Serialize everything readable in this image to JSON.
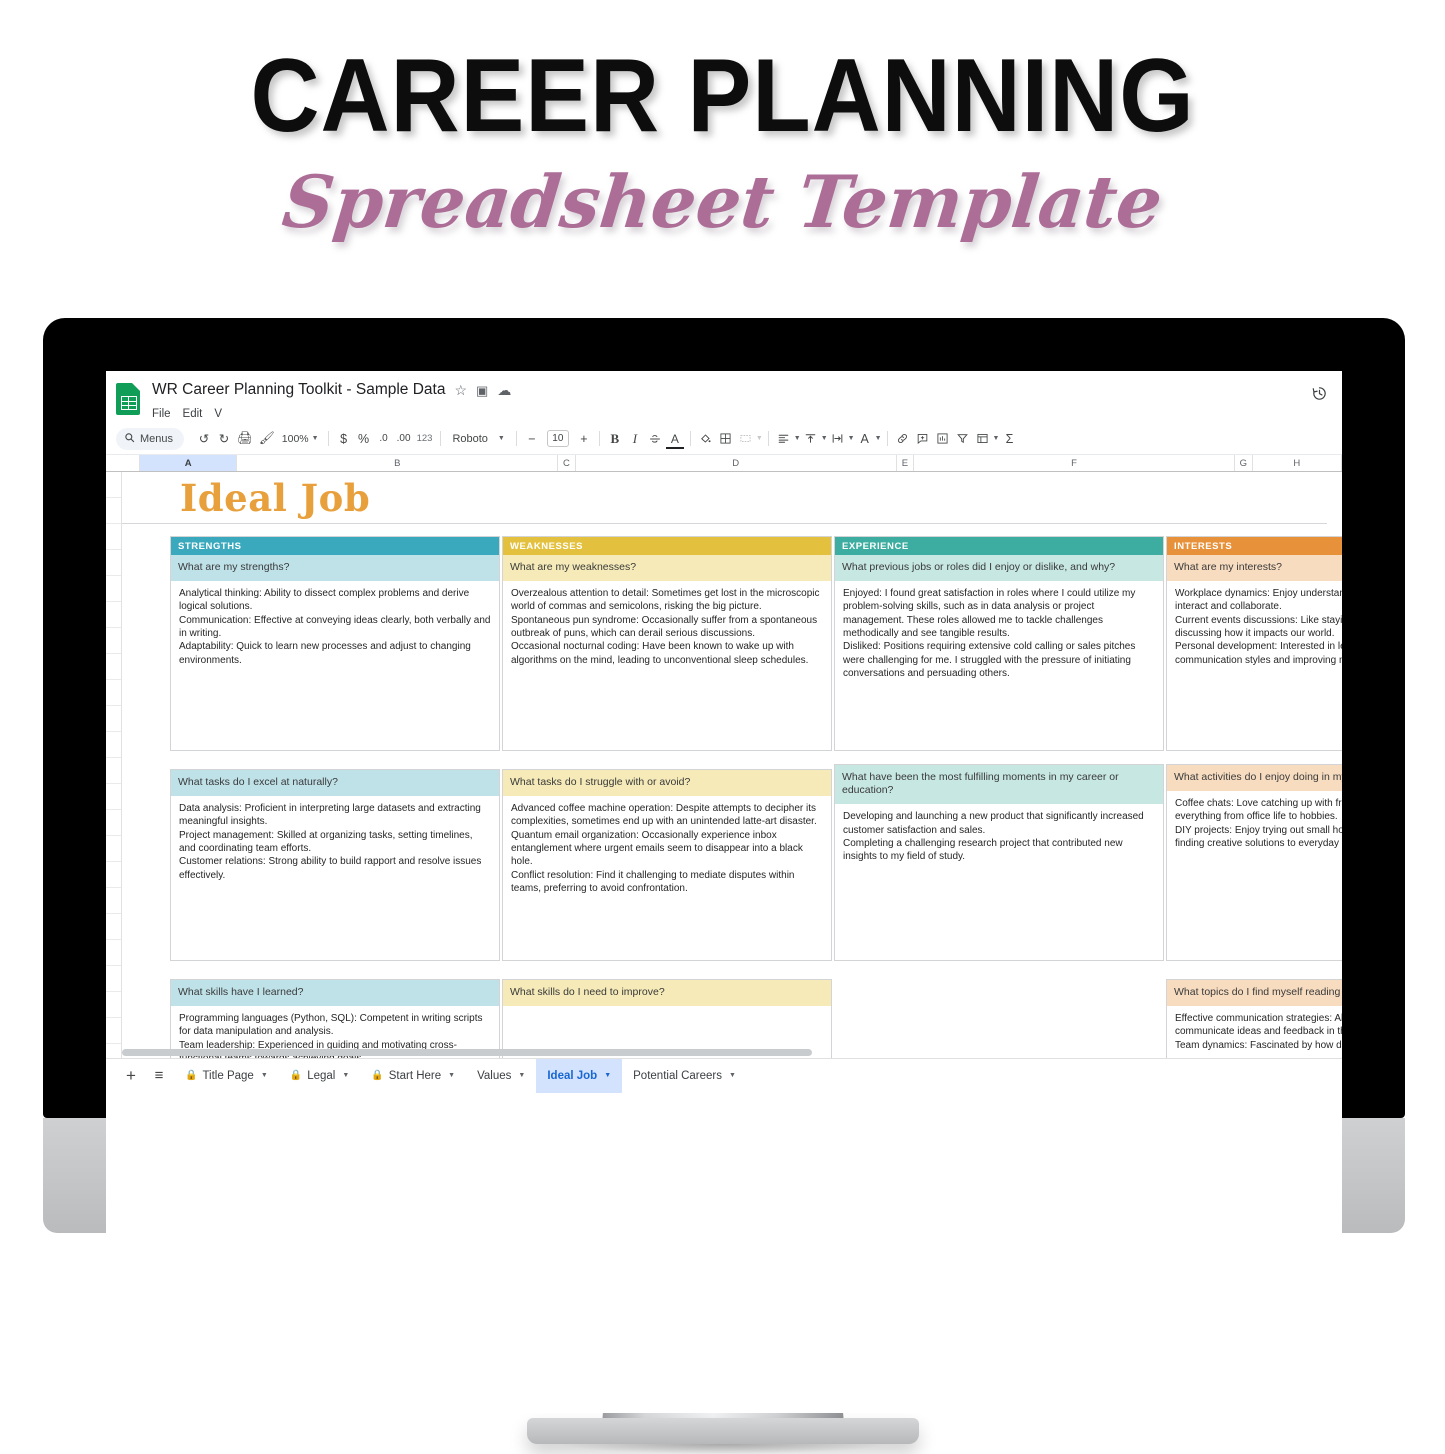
{
  "promo": {
    "title": "CAREER PLANNING",
    "subtitle": "Spreadsheet Template"
  },
  "app": {
    "filename": "WR Career Planning Toolkit - Sample Data",
    "icons": {
      "doc": "sheets-logo",
      "star": "☆",
      "move": "▣",
      "cloud": "☁",
      "history": "🕘"
    },
    "menus": [
      "File",
      "Edit",
      "V"
    ]
  },
  "toolbar": {
    "menus_label": "Menus",
    "search_icon": "search-icon",
    "undo": "↺",
    "redo": "↻",
    "print": "🖨",
    "paint": "🖌",
    "zoom": "100%",
    "currency": "$",
    "percent": "%",
    "decrease_decimal": ".0",
    "increase_decimal": ".00",
    "more_formats": "123",
    "font": "Roboto",
    "font_size": "10",
    "size_minus": "−",
    "size_plus": "+",
    "bold": "B",
    "italic": "I",
    "strikethrough": "S",
    "text_color": "A",
    "fill_color": "🖍",
    "borders": "▦",
    "merge": "⧉",
    "halign": "≡",
    "valign": "⊤",
    "wrap": "↵",
    "rotate": "A",
    "link": "🔗",
    "comment": "⊞",
    "chart": "▥",
    "filter": "▽",
    "pivot": "▤",
    "functions": "Σ"
  },
  "columns": [
    "A",
    "B",
    "C",
    "D",
    "E",
    "F",
    "G",
    "H"
  ],
  "selected_column": "A",
  "sheet": {
    "title": "Ideal Job",
    "cards": [
      {
        "id": "strengths",
        "theme": "t-str",
        "caption": "STRENGTHS",
        "question": "What are my strengths?",
        "body": "Analytical thinking: Ability to dissect complex problems and derive logical solutions.\nCommunication: Effective at conveying ideas clearly, both verbally and in writing.\nAdaptability: Quick to learn new processes and adjust to changing environments."
      },
      {
        "id": "weaknesses",
        "theme": "t-wk",
        "caption": "WEAKNESSES",
        "question": "What are my weaknesses?",
        "body": "Overzealous attention to detail: Sometimes get lost in the microscopic world of commas and semicolons, risking the big picture.\nSpontaneous pun syndrome: Occasionally suffer from a spontaneous outbreak of puns, which can derail serious discussions.\nOccasional nocturnal coding: Have been known to wake up with algorithms on the mind, leading to unconventional sleep schedules."
      },
      {
        "id": "experience",
        "theme": "t-exp",
        "caption": "EXPERIENCE",
        "question": "What previous jobs or roles did I enjoy or dislike, and why?",
        "body": "Enjoyed: I found great satisfaction in roles where I could utilize my problem-solving skills, such as in data analysis or project management. These roles allowed me to tackle challenges methodically and see tangible results.\nDisliked: Positions requiring extensive cold calling or sales pitches were challenging for me. I struggled with the pressure of initiating conversations and persuading others."
      },
      {
        "id": "interests",
        "theme": "t-int",
        "caption": "INTERESTS",
        "question": "What are my interests?",
        "body": "Workplace dynamics: Enjoy understanding how different personalities interact and collaborate.\nCurrent events discussions: Like staying informed on the news and discussing how it impacts our world.\nPersonal development: Interested in learning about different communication styles and improving my own."
      },
      {
        "id": "excel-tasks",
        "theme": "t-str",
        "caption": "",
        "question": "What tasks do I excel at naturally?",
        "body": "Data analysis: Proficient in interpreting large datasets and extracting meaningful insights.\nProject management: Skilled at organizing tasks, setting timelines, and coordinating team efforts.\nCustomer relations: Strong ability to build rapport and resolve issues effectively."
      },
      {
        "id": "struggle-tasks",
        "theme": "t-wk",
        "caption": "",
        "question": "What tasks do I struggle with or avoid?",
        "body": "Advanced coffee machine operation: Despite attempts to decipher its complexities, sometimes end up with an unintended latte-art disaster.\nQuantum email organization: Occasionally experience inbox entanglement where urgent emails seem to disappear into a black hole.\nConflict resolution: Find it challenging to mediate disputes within teams, preferring to avoid confrontation."
      },
      {
        "id": "fulfilling-moments",
        "theme": "t-exp",
        "caption": "",
        "question": "What have been the most fulfilling moments in my career or education?",
        "body": "Developing and launching a new product that significantly increased customer satisfaction and sales.\nCompleting a challenging research project that contributed new insights to my field of study."
      },
      {
        "id": "enjoy-activities",
        "theme": "t-int",
        "caption": "",
        "question": "What activities do I enjoy doing in my free time?",
        "body": "Coffee chats: Love catching up with friends over coffee and discussing everything from office life to hobbies.\nDIY projects: Enjoy trying out small home improvement tasks and finding creative solutions to everyday problems."
      },
      {
        "id": "skills-learned",
        "theme": "t-str",
        "caption": "",
        "question": "What skills have I learned?",
        "body": "Programming languages (Python, SQL): Competent in writing scripts for data manipulation and analysis.\nTeam leadership: Experienced in guiding and motivating cross-functional teams towards achieving goals."
      },
      {
        "id": "skills-improve",
        "theme": "t-wk",
        "caption": "",
        "question": "What skills do I need to improve?",
        "body": ""
      },
      {
        "id": "reading-topics",
        "theme": "t-int",
        "caption": "",
        "question": "What topics do I find myself reading about?",
        "body": "Effective communication strategies: Always looking to improve how we communicate ideas and feedback in the workplace.\nTeam dynamics: Fascinated by how diverse teams work together."
      }
    ]
  },
  "tabs": {
    "add_label": "+",
    "all_sheets_label": "≡",
    "items": [
      {
        "label": "Title Page",
        "locked": true,
        "active": false
      },
      {
        "label": "Legal",
        "locked": true,
        "active": false
      },
      {
        "label": "Start Here",
        "locked": true,
        "active": false
      },
      {
        "label": "Values",
        "locked": false,
        "active": false
      },
      {
        "label": "Ideal Job",
        "locked": false,
        "active": true
      },
      {
        "label": "Potential Careers",
        "locked": false,
        "active": false
      }
    ]
  },
  "colors": {
    "strengths": "#3aa9bd",
    "weaknesses": "#e3c13f",
    "experience": "#3dada1",
    "interests": "#e8913b",
    "title_orange": "#e8a03c",
    "subtitle_mauve": "#ac6e97",
    "sheets_green": "#0f9d58",
    "tab_active_blue": "#1967d2"
  }
}
